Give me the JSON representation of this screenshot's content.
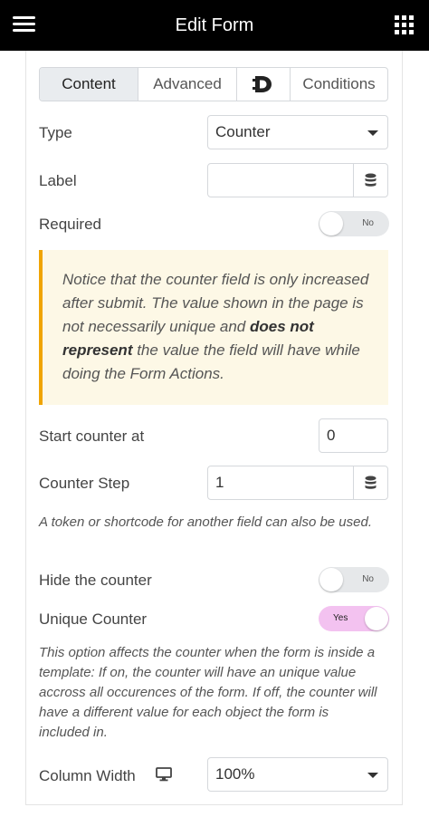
{
  "header": {
    "title": "Edit Form",
    "menu_icon": "hamburger-menu-icon",
    "apps_icon": "grid-icon"
  },
  "tabs": [
    {
      "label": "Content",
      "active": true
    },
    {
      "label": "Advanced",
      "active": false
    },
    {
      "label": "",
      "icon": "dynamic-d-icon",
      "active": false
    },
    {
      "label": "Conditions",
      "active": false
    }
  ],
  "fields": {
    "type": {
      "label": "Type",
      "value": "Counter"
    },
    "label": {
      "label": "Label",
      "value": "",
      "icon": "database-icon"
    },
    "required": {
      "label": "Required",
      "toggle": "No",
      "on": false
    },
    "notice": {
      "part1": "Notice that the counter field is only increased after submit. The value shown in the page is not necessarily unique and ",
      "bold": "does not represent",
      "part2": " the value the field will have while doing the Form Actions."
    },
    "start_counter": {
      "label": "Start counter at",
      "value": "0"
    },
    "counter_step": {
      "label": "Counter Step",
      "value": "1",
      "icon": "database-icon"
    },
    "token_hint": "A token or shortcode for another field can also be used.",
    "hide_counter": {
      "label": "Hide the counter",
      "toggle": "No",
      "on": false
    },
    "unique_counter": {
      "label": "Unique Counter",
      "toggle": "Yes",
      "on": true
    },
    "unique_hint": "This option affects the counter when the form is inside a template: If on, the counter will have an unique value accross all occurences of the form. If off, the counter will have a different value for each object the form is included in.",
    "column_width": {
      "label": "Column Width",
      "value": "100%",
      "icon": "desktop-monitor-icon"
    }
  },
  "colors": {
    "header_bg": "#000000",
    "notice_bg": "#fdf8e6",
    "notice_border": "#f0a400",
    "toggle_on": "#f3c2f0",
    "toggle_off": "#e6e8ea"
  }
}
